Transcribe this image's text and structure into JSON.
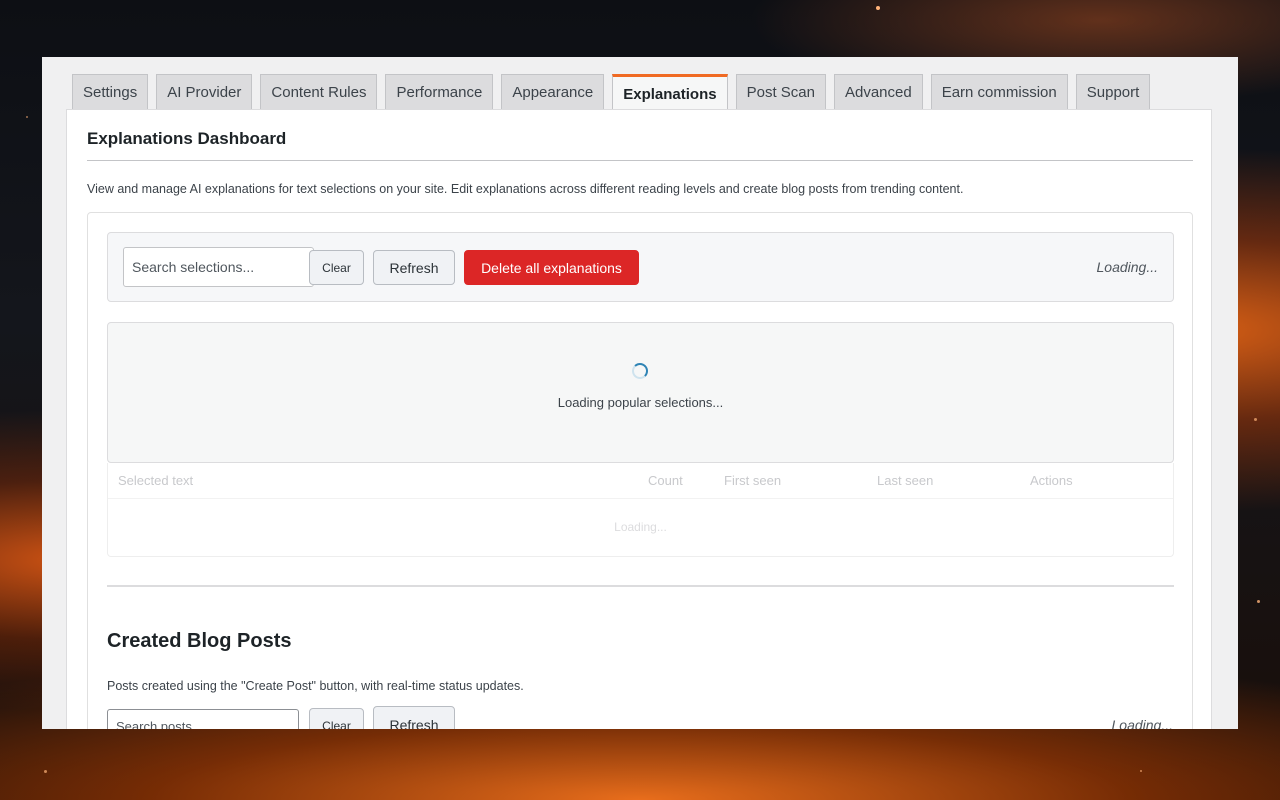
{
  "tabs": [
    {
      "label": "Settings"
    },
    {
      "label": "AI Provider"
    },
    {
      "label": "Content Rules"
    },
    {
      "label": "Performance"
    },
    {
      "label": "Appearance"
    },
    {
      "label": "Explanations"
    },
    {
      "label": "Post Scan"
    },
    {
      "label": "Advanced"
    },
    {
      "label": "Earn commission"
    },
    {
      "label": "Support"
    }
  ],
  "active_tab": "Explanations",
  "accent_color": "#f06a23",
  "danger_color": "#dc2626",
  "dashboard": {
    "title": "Explanations Dashboard",
    "description": "View and manage AI explanations for text selections on your site. Edit explanations across different reading levels and create blog posts from trending content.",
    "search_placeholder": "Search selections...",
    "clear_label": "Clear",
    "refresh_label": "Refresh",
    "delete_all_label": "Delete all explanations",
    "status": "Loading...",
    "loading_message": "Loading popular selections...",
    "table": {
      "columns": [
        "Selected text",
        "Count",
        "First seen",
        "Last seen",
        "Actions"
      ],
      "body_status": "Loading..."
    }
  },
  "blog_posts": {
    "title": "Created Blog Posts",
    "description": "Posts created using the \"Create Post\" button, with real-time status updates.",
    "search_placeholder": "Search posts...",
    "clear_label": "Clear",
    "refresh_label": "Refresh",
    "status": "Loading..."
  }
}
